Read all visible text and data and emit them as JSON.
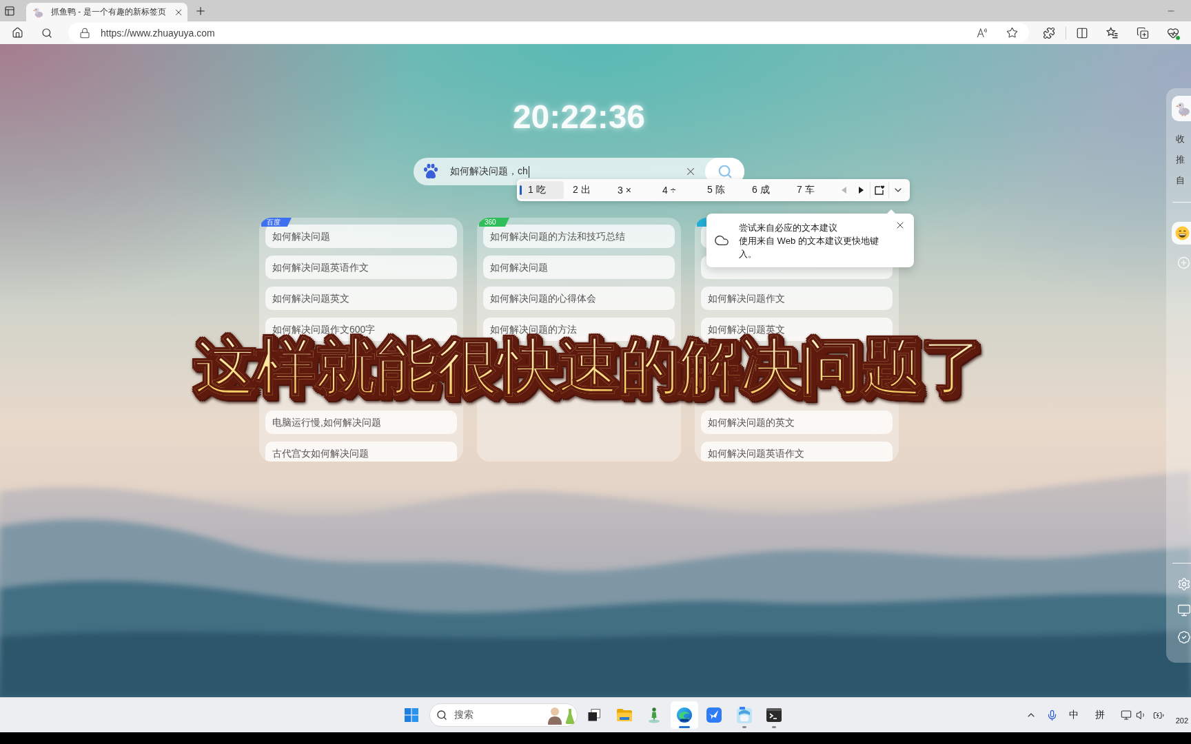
{
  "browser": {
    "tab": {
      "title": "抓鱼鸭 - 是一个有趣的新标签页",
      "selected": true
    },
    "address": {
      "url": "https://www.zhuayuya.com"
    }
  },
  "page": {
    "clock": "20:22:36",
    "search": {
      "value": "如何解决问题，ch"
    },
    "ime": {
      "candidates": [
        {
          "label": "1 吃",
          "selected": true
        },
        {
          "label": "2 出",
          "selected": false
        },
        {
          "label": "3 ×",
          "selected": false
        },
        {
          "label": "4 ÷",
          "selected": false
        },
        {
          "label": "5 陈",
          "selected": false
        },
        {
          "label": "6 成",
          "selected": false
        },
        {
          "label": "7 车",
          "selected": false
        }
      ],
      "paging": [
        {
          "kind": "prev",
          "disabled": true
        },
        {
          "kind": "next",
          "disabled": false
        }
      ]
    },
    "suggestion_tip": {
      "title": "尝试来自必应的文本建议",
      "body": "使用来自 Web 的文本建议更快地键入。"
    },
    "columns": [
      {
        "badge": {
          "label": "百度",
          "color": "#3d6ff0"
        },
        "items": [
          {
            "kind": "text",
            "text": "如何解决问题"
          },
          {
            "kind": "text",
            "text": "如何解决问题英语作文"
          },
          {
            "kind": "text",
            "text": "如何解决问题英文"
          },
          {
            "kind": "text",
            "text": "如何解决问题作文600字"
          },
          {
            "kind": "hidden"
          },
          {
            "kind": "hidden"
          },
          {
            "kind": "text",
            "text": "电脑运行慢,如何解决问题"
          },
          {
            "kind": "text",
            "text": "古代宫女如何解决问题"
          }
        ]
      },
      {
        "badge": {
          "label": "360",
          "color": "#2fbf5a"
        },
        "items": [
          {
            "kind": "text",
            "text": "如何解决问题的方法和技巧总结"
          },
          {
            "kind": "text",
            "text": "如何解决问题"
          },
          {
            "kind": "text",
            "text": "如何解决问题的心得体会"
          },
          {
            "kind": "text",
            "text": "如何解决问题的方法"
          },
          {
            "kind": "hidden"
          },
          {
            "kind": "hidden"
          }
        ]
      },
      {
        "badge": {
          "color": "#23b0d6"
        },
        "items": [
          {
            "kind": "covered"
          },
          {
            "kind": "covered"
          },
          {
            "kind": "text",
            "text": "如何解决问题作文"
          },
          {
            "kind": "text",
            "text": "如何解决问题英文"
          },
          {
            "kind": "hidden"
          },
          {
            "kind": "hidden"
          },
          {
            "kind": "text",
            "text": "如何解决问题的英文"
          },
          {
            "kind": "text",
            "text": "如何解决问题英语作文"
          }
        ]
      }
    ],
    "subtitle": "这样就能很快速的解决问题了"
  },
  "sidebar": {
    "labels": [
      "收",
      "推",
      "自"
    ]
  },
  "taskbar": {
    "search": {
      "placeholder": "搜索"
    },
    "apps": [
      {
        "kind": "task-view",
        "running": false,
        "selected": false
      },
      {
        "kind": "files",
        "running": false,
        "selected": false
      },
      {
        "kind": "figure",
        "running": false,
        "selected": false
      },
      {
        "kind": "browser",
        "running": true,
        "selected": true
      },
      {
        "kind": "bird",
        "running": false,
        "selected": false
      },
      {
        "kind": "picture",
        "running": true,
        "selected": false
      },
      {
        "kind": "terminal",
        "running": true,
        "selected": false
      }
    ],
    "tray": {
      "language": "中",
      "input_method": "拼",
      "date": "202"
    }
  }
}
